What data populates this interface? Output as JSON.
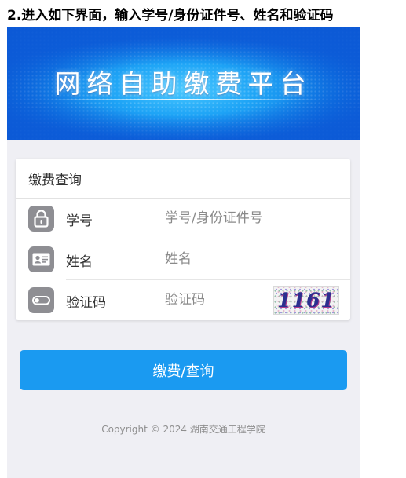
{
  "instruction": "2.进入如下界面，输入学号/身份证件号、姓名和验证码",
  "banner": {
    "title": "网络自助缴费平台"
  },
  "form": {
    "title": "缴费查询",
    "rows": [
      {
        "label": "学号",
        "placeholder": "学号/身份证件号",
        "value": "",
        "icon": "lock-icon"
      },
      {
        "label": "姓名",
        "placeholder": "姓名",
        "value": "",
        "icon": "id-card-icon"
      },
      {
        "label": "验证码",
        "placeholder": "验证码",
        "value": "",
        "icon": "toggle-icon"
      }
    ],
    "captcha_text": "1161"
  },
  "submit_label": "缴费/查询",
  "footer": "Copyright © 2024 湖南交通工程学院",
  "colors": {
    "primary": "#1a9af1",
    "icon_bg": "#8e8e93",
    "page_bg": "#efeff4"
  }
}
